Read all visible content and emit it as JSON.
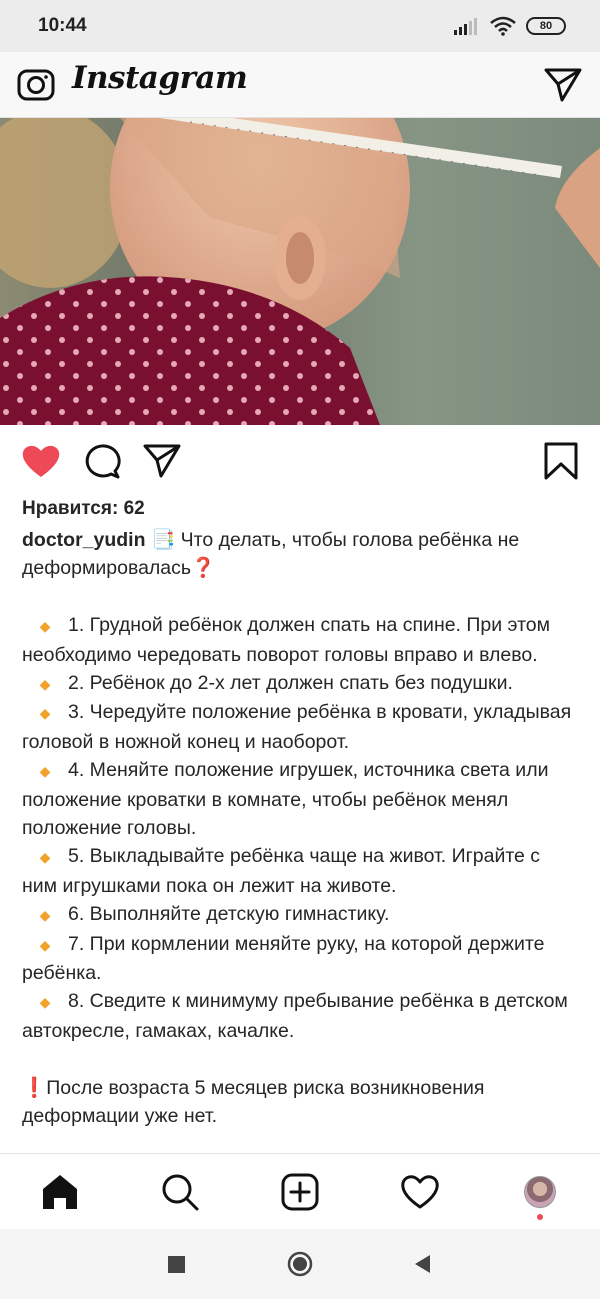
{
  "status_bar": {
    "time": "10:44",
    "battery": "80"
  },
  "header": {
    "logo": "Instagram"
  },
  "post": {
    "likes_text": "Нравится: 62",
    "author": "doctor_yudin",
    "caption_title": "Что делать, чтобы голова ребёнка не деформировалась",
    "title_emoji": "📑",
    "question_emoji": "❓",
    "bullet_emoji": "🔸",
    "items": [
      "1. Грудной ребёнок должен спать на спине. При этом необходимо чередовать поворот головы вправо и влево.",
      "2. Ребёнок до 2-х лет должен спать без подушки.",
      "3. Чередуйте положение ребёнка в кровати, укладывая головой в ножной конец и наоборот.",
      "4. Меняйте положение игрушек, источника света или положение кроватки в комнате, чтобы ребёнок менял положение головы.",
      "5. Выкладывайте ребёнка чаще на живот. Играйте с ним игрушками пока он лежит на животе.",
      "6. Выполняйте детскую гимнастику.",
      "7. При кормлении меняйте руку, на которой держите ребёнка.",
      "8. Сведите к минимуму пребывание ребёнка в детском автокресле, гамаках, качалке."
    ],
    "warning_emoji": "❗",
    "warning_text": "После возраста 5 месяцев риска возникновения деформации уже нет.",
    "liked": true
  },
  "icons": {
    "camera": "camera-icon",
    "direct": "direct-message-icon",
    "like": "heart-icon",
    "comment": "comment-icon",
    "share": "share-icon",
    "save": "bookmark-icon",
    "home": "home-icon",
    "search": "search-icon",
    "new_post": "add-post-icon",
    "activity": "heart-outline-icon",
    "profile": "avatar",
    "sys_recents": "square-icon",
    "sys_home": "circle-icon",
    "sys_back": "triangle-back-icon"
  },
  "colors": {
    "like_red": "#ed4956",
    "bullet_orange": "#f2a229",
    "text": "#262626"
  }
}
